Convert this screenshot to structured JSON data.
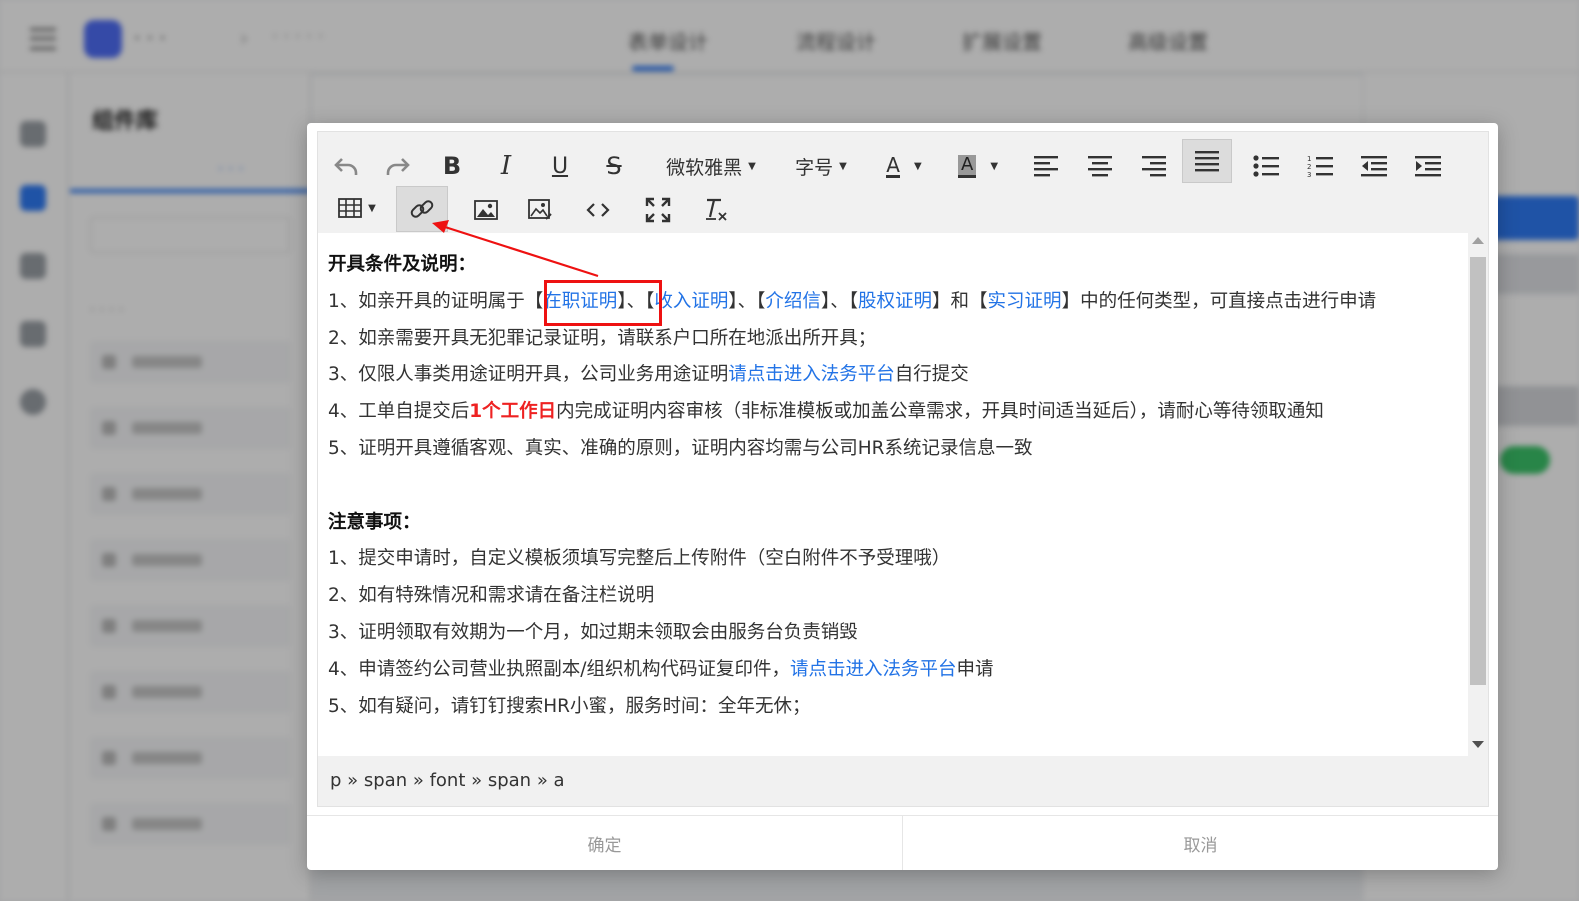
{
  "background": {
    "tabs": [
      "表单设计",
      "流程设计",
      "扩展设置",
      "高级设置"
    ],
    "panel_title": "组件库",
    "accent_color": "#2f7bf5"
  },
  "editor": {
    "toolbar": {
      "font_family": "微软雅黑",
      "font_size": "字号",
      "text_color_label": "A",
      "bg_color_label": "A",
      "icons": [
        "undo-icon",
        "redo-icon",
        "bold-icon",
        "italic-icon",
        "underline-icon",
        "strikethrough-icon",
        "align-left-icon",
        "align-center-icon",
        "align-right-icon",
        "align-justify-icon",
        "bullet-list-icon",
        "numbered-list-icon",
        "outdent-icon",
        "indent-icon",
        "table-icon",
        "link-icon",
        "image-icon",
        "image-edit-icon",
        "code-icon",
        "fullscreen-icon",
        "clear-format-icon"
      ]
    },
    "content": {
      "section1_title": "开具条件及说明：",
      "s1_line1": {
        "prefix": "1、如亲开具的证明属于",
        "lb": "【",
        "rb": "】",
        "link1": "在职证明",
        "sep1": "、",
        "link2": "收入证明",
        "sep2": "、",
        "link3": "介绍信",
        "sep3": "、",
        "link4": "股权证明",
        "and": "和",
        "link5": "实习证明",
        "suffix": "中的任何类型，可直接点击进行申请"
      },
      "s1_line2": "2、如亲需要开具无犯罪记录证明，请联系户口所在地派出所开具；",
      "s1_line3": {
        "prefix": "3、仅限人事类用途证明开具，公司业务用途证明",
        "link": "请点击进入法务平台",
        "suffix": "自行提交"
      },
      "s1_line4": {
        "prefix": "4、工单自提交后",
        "highlight": "1个工作日",
        "suffix": "内完成证明内容审核（非标准模板或加盖公章需求，开具时间适当延后），请耐心等待领取通知"
      },
      "s1_line5": "5、证明开具遵循客观、真实、准确的原则，证明内容均需与公司HR系统记录信息一致",
      "section2_title": "注意事项：",
      "s2_line1": "1、提交申请时，自定义模板须填写完整后上传附件（空白附件不予受理哦）",
      "s2_line2": "2、如有特殊情况和需求请在备注栏说明",
      "s2_line3": "3、证明领取有效期为一个月，如过期未领取会由服务台负责销毁",
      "s2_line4": {
        "prefix": "4、申请签约公司营业执照副本/组织机构代码证复印件，",
        "link": "请点击进入法务平台",
        "suffix": "申请"
      },
      "s2_line5": "5、如有疑问，请钉钉搜索HR小蜜，服务时间：全年无休；"
    },
    "status_path": "p » span » font » span » a",
    "link_color": "#2273e6",
    "highlight_color": "#ee2222",
    "annotation_color": "#ee1111"
  },
  "footer": {
    "confirm": "确定",
    "cancel": "取消"
  }
}
